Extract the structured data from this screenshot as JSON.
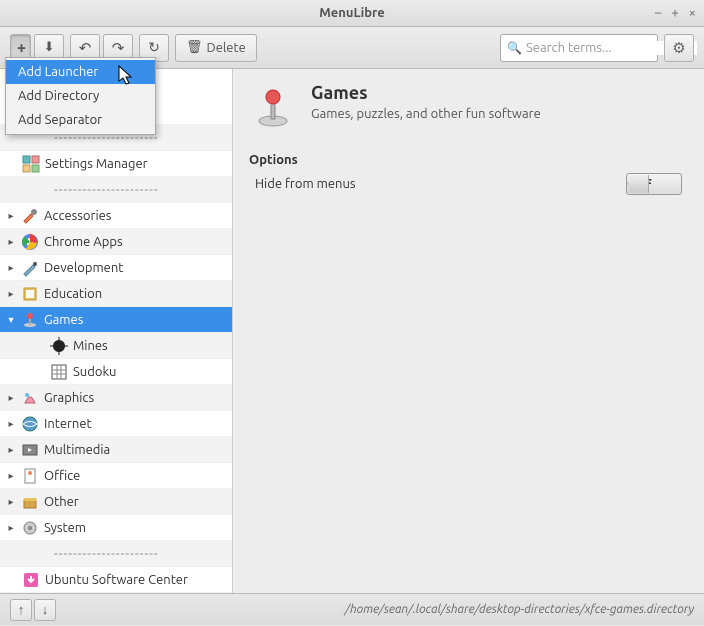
{
  "window": {
    "title": "MenuLibre"
  },
  "toolbar": {
    "delete_label": "Delete",
    "search_placeholder": "Search terms..."
  },
  "dropdown": {
    "items": [
      {
        "label": "Add Launcher",
        "hover": true
      },
      {
        "label": "Add Directory",
        "hover": false
      },
      {
        "label": "Add Separator",
        "hover": false
      }
    ]
  },
  "tree": [
    {
      "type": "spacer"
    },
    {
      "type": "sep"
    },
    {
      "type": "item",
      "indent": 1,
      "label": "Settings Manager",
      "icon": "settings"
    },
    {
      "type": "sep"
    },
    {
      "type": "cat",
      "label": "Accessories",
      "icon": "accessories",
      "expanded": false
    },
    {
      "type": "cat",
      "label": "Chrome Apps",
      "icon": "chrome",
      "expanded": false
    },
    {
      "type": "cat",
      "label": "Development",
      "icon": "dev",
      "expanded": false
    },
    {
      "type": "cat",
      "label": "Education",
      "icon": "edu",
      "expanded": false
    },
    {
      "type": "cat",
      "label": "Games",
      "icon": "games",
      "expanded": true,
      "selected": true
    },
    {
      "type": "item",
      "indent": 2,
      "label": "Mines",
      "icon": "mines"
    },
    {
      "type": "item",
      "indent": 2,
      "label": "Sudoku",
      "icon": "sudoku"
    },
    {
      "type": "cat",
      "label": "Graphics",
      "icon": "graphics",
      "expanded": false
    },
    {
      "type": "cat",
      "label": "Internet",
      "icon": "internet",
      "expanded": false
    },
    {
      "type": "cat",
      "label": "Multimedia",
      "icon": "multimedia",
      "expanded": false
    },
    {
      "type": "cat",
      "label": "Office",
      "icon": "office",
      "expanded": false
    },
    {
      "type": "cat",
      "label": "Other",
      "icon": "other",
      "expanded": false
    },
    {
      "type": "cat",
      "label": "System",
      "icon": "system",
      "expanded": false
    },
    {
      "type": "sep"
    },
    {
      "type": "item",
      "indent": 1,
      "label": "Ubuntu Software Center",
      "icon": "usc"
    },
    {
      "type": "sep"
    }
  ],
  "detail": {
    "title": "Games",
    "description": "Games, puzzles, and other fun software",
    "options_label": "Options",
    "hide_label": "Hide from menus",
    "hide_state": "OFF"
  },
  "status": {
    "path": "/home/sean/.local/share/desktop-directories/xfce-games.directory"
  }
}
